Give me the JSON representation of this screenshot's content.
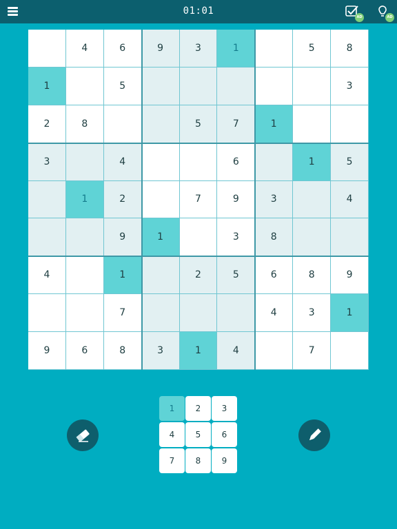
{
  "header": {
    "timer": "01:01",
    "menu_icon": "hamburger-menu-icon",
    "check_icon": "check-hint-icon",
    "check_badge": "AD",
    "hint_icon": "lightbulb-hint-icon",
    "hint_badge": "AD"
  },
  "board": {
    "size": 9,
    "rows": [
      [
        "",
        "4",
        "6",
        "9",
        "3",
        "1",
        "",
        "5",
        "8"
      ],
      [
        "1",
        "",
        "5",
        "",
        "",
        "",
        "",
        "",
        "3"
      ],
      [
        "2",
        "8",
        "",
        "",
        "5",
        "7",
        "1",
        "",
        ""
      ],
      [
        "3",
        "",
        "4",
        "",
        "",
        "6",
        "",
        "1",
        "5"
      ],
      [
        "",
        "1",
        "2",
        "",
        "7",
        "9",
        "3",
        "",
        "4"
      ],
      [
        "",
        "",
        "9",
        "1",
        "",
        "3",
        "8",
        "",
        ""
      ],
      [
        "4",
        "",
        "1",
        "",
        "2",
        "5",
        "6",
        "8",
        "9"
      ],
      [
        "",
        "",
        "7",
        "",
        "",
        "",
        "4",
        "3",
        "1"
      ],
      [
        "9",
        "6",
        "8",
        "3",
        "1",
        "4",
        "",
        "7",
        ""
      ]
    ],
    "user_entered": [
      [
        0,
        5
      ],
      [
        4,
        1
      ]
    ],
    "highlighted_cells": [
      [
        0,
        5
      ],
      [
        1,
        0
      ],
      [
        2,
        6
      ],
      [
        3,
        7
      ],
      [
        4,
        1
      ],
      [
        5,
        3
      ],
      [
        6,
        2
      ],
      [
        7,
        8
      ],
      [
        8,
        4
      ]
    ],
    "shaded_regions": [
      1,
      3,
      5,
      7
    ],
    "colors": {
      "background": "#00adc1",
      "topbar": "#0c5f6e",
      "shade": "#e2f0f2",
      "highlight": "#5fd3d6",
      "user_digit": "#137b8c",
      "given_digit": "#1d3d40"
    }
  },
  "controls": {
    "erase_icon": "eraser-icon",
    "notes_icon": "pencil-icon",
    "keypad": [
      "1",
      "2",
      "3",
      "4",
      "5",
      "6",
      "7",
      "8",
      "9"
    ],
    "selected_number": "1"
  }
}
